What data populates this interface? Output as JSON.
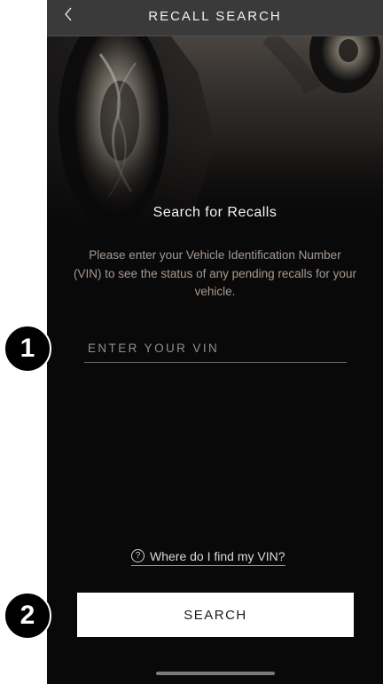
{
  "header": {
    "title": "RECALL SEARCH",
    "back_icon": "chevron-left-icon"
  },
  "main": {
    "heading": "Search for Recalls",
    "description": "Please enter your Vehicle Identification Number (VIN) to see the status of any pending recalls for your vehicle.",
    "vin_input": {
      "placeholder": "ENTER YOUR VIN",
      "value": ""
    },
    "help_link": {
      "icon": "question-circle-icon",
      "label": "Where do I find my VIN?"
    },
    "search_button": "SEARCH"
  },
  "annotations": {
    "step_1": "1",
    "step_2": "2"
  },
  "colors": {
    "background": "#0a0909",
    "header": "#3a3a3a",
    "description_text": "#a59a91",
    "button": "#ffffff"
  }
}
